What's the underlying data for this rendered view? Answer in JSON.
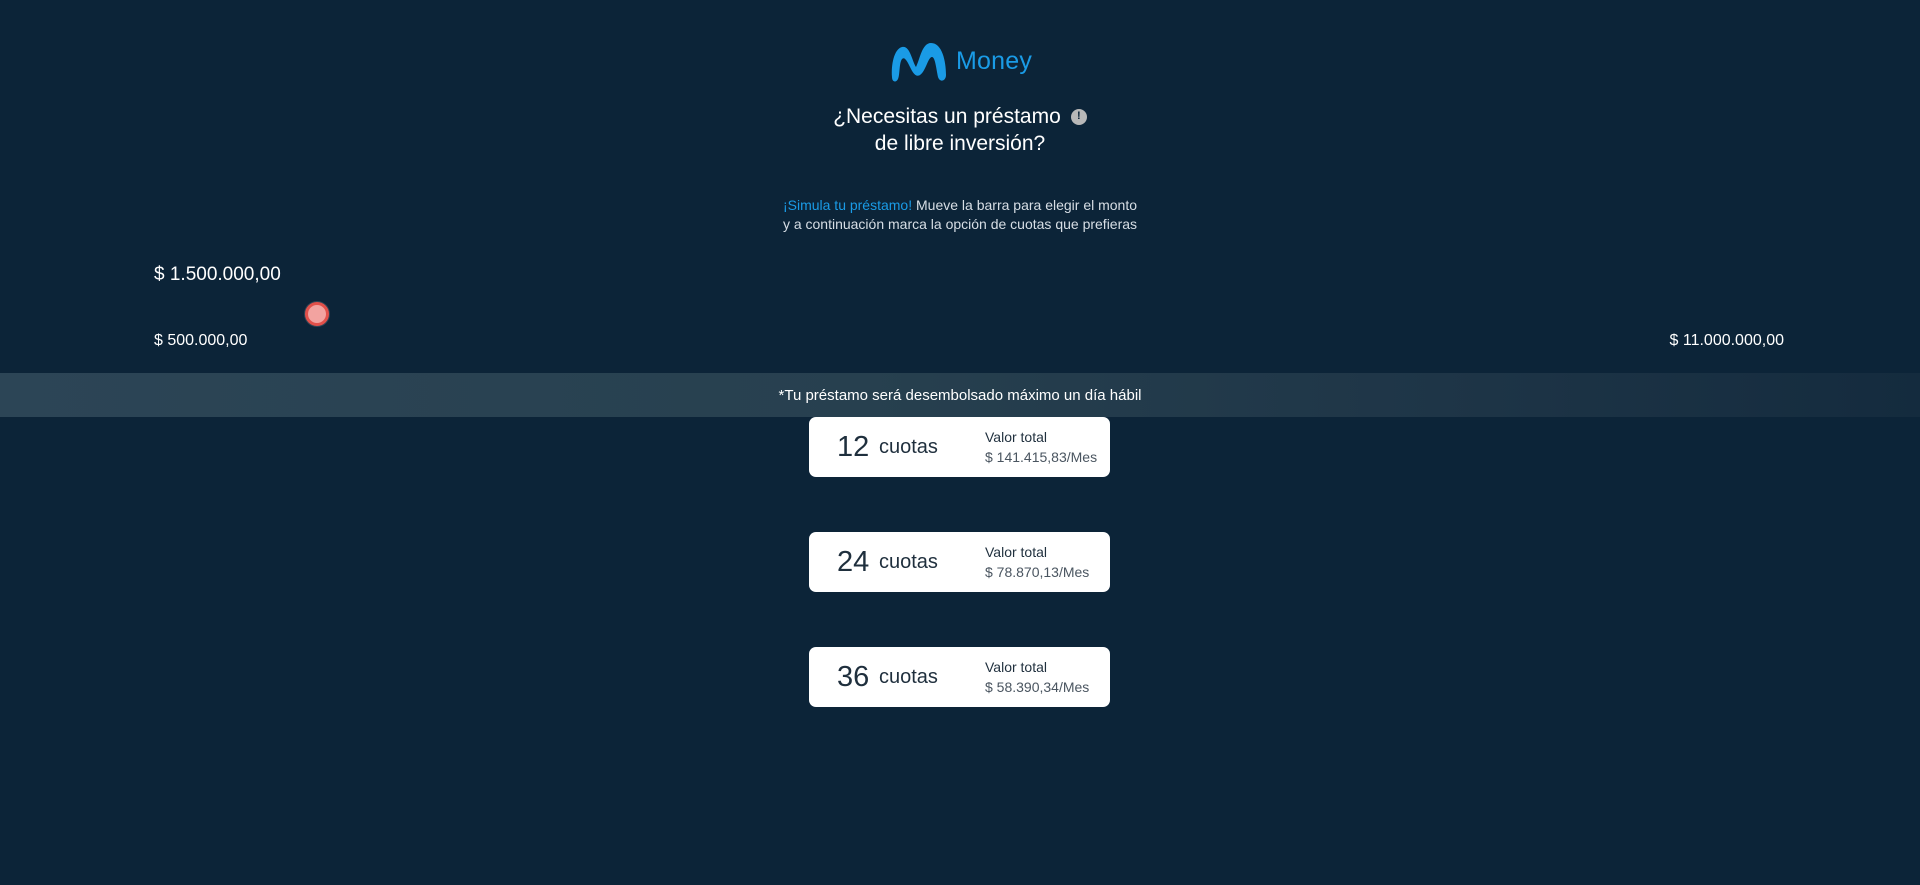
{
  "brand": {
    "name": "Money",
    "color": "#1a9be6"
  },
  "header": {
    "title_line1": "¿Necesitas un préstamo",
    "title_line2": "de libre inversión?",
    "info_icon": "info-icon"
  },
  "intro": {
    "highlight": "¡Simula tu préstamo!",
    "text_line1": " Mueve la barra para elegir el monto",
    "text_line2": "y a continuación marca la opción de cuotas que prefieras"
  },
  "slider": {
    "current_amount": "$ 1.500.000,00",
    "min_label": "$ 500.000,00",
    "max_label": "$ 11.000.000,00",
    "value_fraction": 0.095
  },
  "notice": {
    "text": "*Tu préstamo será desembolsado máximo un día hábil"
  },
  "installments": [
    {
      "count": "12",
      "unit": "cuotas",
      "label": "Valor total",
      "value": "$ 141.415,83/Mes"
    },
    {
      "count": "24",
      "unit": "cuotas",
      "label": "Valor total",
      "value": "$ 78.870,13/Mes"
    },
    {
      "count": "36",
      "unit": "cuotas",
      "label": "Valor total",
      "value": "$ 58.390,34/Mes"
    }
  ],
  "colors": {
    "background": "#0c2438",
    "thumb": "#e2504a"
  }
}
